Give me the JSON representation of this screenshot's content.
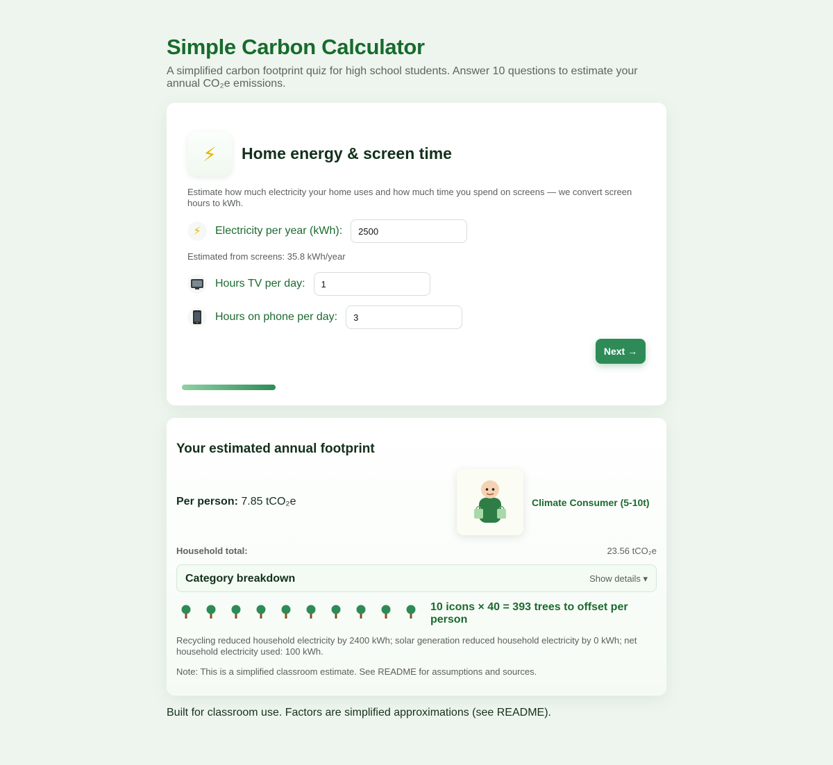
{
  "header": {
    "title": "Simple Carbon Calculator",
    "subtitle": "A simplified carbon footprint quiz for high school students. Answer 10 questions to estimate your annual CO₂e emissions."
  },
  "quiz": {
    "step_icon": "lightning-icon",
    "step_title": "Home energy & screen time",
    "step_description": "Estimate how much electricity your home uses and how much time you spend on screens — we convert screen hours to kWh.",
    "fields": [
      {
        "icon": "lightning-icon",
        "label": "Electricity per year (kWh):",
        "value": "2500"
      },
      {
        "icon": "tv-icon",
        "label": "Hours TV per day:",
        "value": "1"
      },
      {
        "icon": "phone-icon",
        "label": "Hours on phone per day:",
        "value": "3"
      }
    ],
    "screen_estimate": "Estimated from screens: 35.8 kWh/year",
    "next_label": "Next →",
    "progress_fraction": 0.2
  },
  "results": {
    "title": "Your estimated annual footprint",
    "per_person_label": "Per person:",
    "per_person_value": "7.85 tCO₂e",
    "persona_label": "Climate Consumer (5-10t)",
    "household_label": "Household total:",
    "household_value": "23.56 tCO₂e",
    "breakdown_title": "Category breakdown",
    "breakdown_toggle": "Show details ▾",
    "tree_icon_count": 10,
    "trees_text": "10 icons × 40 = 393 trees to offset per person",
    "recycling_note": "Recycling reduced household electricity by 2400 kWh; solar generation reduced household electricity by 0 kWh; net household electricity used: 100 kWh.",
    "classroom_note": "Note: This is a simplified classroom estimate. See README for assumptions and sources."
  },
  "footer": "Built for classroom use. Factors are simplified approximations (see README).",
  "colors": {
    "brand_green": "#176b2c",
    "button_green": "#2e8b57",
    "background": "#eef5ee"
  }
}
